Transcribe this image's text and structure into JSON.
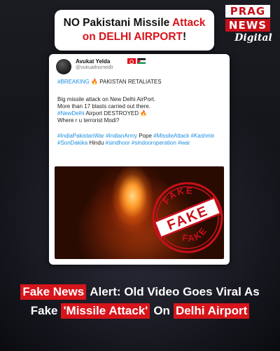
{
  "banner": {
    "line1_pre": "NO Pakistani Missile ",
    "line1_red": "Attack",
    "line2_pre": "on DELHI AIRPORT",
    "line2_post": "!"
  },
  "logo": {
    "line1": "PRAG",
    "line2": "NEWS",
    "line3": "Digital"
  },
  "tweet": {
    "username": "Avukat Yelda",
    "handle": "@vukuatlniznedlr",
    "breaking_tag": "#BREAKING",
    "breaking_text": "PAKISTAN RETALIATES",
    "body_line1": "Big missile attack on New Delhi AirPort.",
    "body_line2": "More than 17 blasts carried out there.",
    "newdelhi_tag": "#NewDelhi",
    "newdelhi_text": "Airport DESTROYED",
    "body_line4": "Where r u terrorist Modi?",
    "tags_line1_a": "#IndiaPakistanWar #IndianArmy",
    "tags_line1_b": "Pope",
    "tags_line1_c": "#MissileAttack #Kashmir",
    "tags_line2_a": "#SonDakika",
    "tags_line2_b": "Hindu",
    "tags_line2_c": "#sindhoor #sindooroperation #war",
    "fire_icon": "🔥"
  },
  "stamp": {
    "text_top": "FAKE",
    "text_middle": "FAKE",
    "text_bottom": "FAKE",
    "color": "#c8101a"
  },
  "caption": {
    "l1_hl": "Fake News",
    "l1_rest": "Alert: Old Video Goes Viral As",
    "l2_a": "Fake",
    "l2_hl1": "'Missile Attack'",
    "l2_b": "On",
    "l2_hl2": "Delhi Airport"
  },
  "colors": {
    "accent_red": "#d8141b",
    "hashtag_blue": "#1d8fe0"
  }
}
